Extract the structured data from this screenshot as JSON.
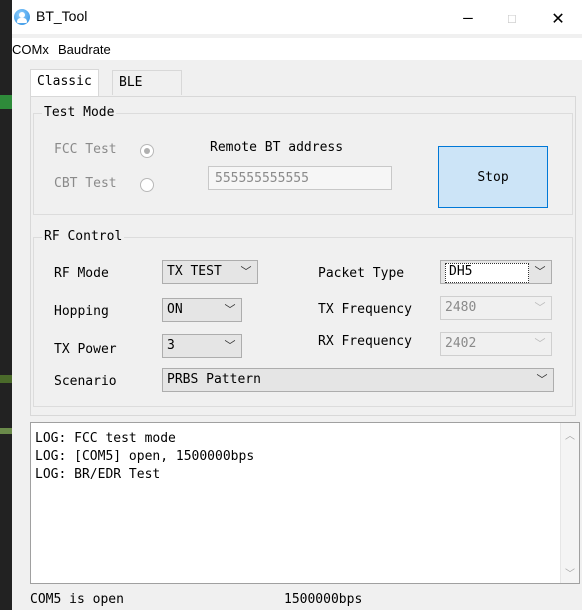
{
  "window": {
    "title": "BT_Tool",
    "minimize_glyph": "—",
    "maximize_glyph": "☐",
    "close_glyph": "✕"
  },
  "menu": {
    "items": [
      "COMx",
      "Baudrate"
    ]
  },
  "tabs": [
    {
      "label": "Classic",
      "active": true
    },
    {
      "label": "BLE",
      "active": false
    }
  ],
  "test_mode": {
    "title": "Test Mode",
    "options": [
      {
        "label": "FCC Test",
        "checked": true
      },
      {
        "label": "CBT Test",
        "checked": false
      }
    ],
    "remote_label": "Remote BT address",
    "remote_value": "555555555555",
    "stop_button": "Stop"
  },
  "rf_control": {
    "title": "RF Control",
    "rf_mode": {
      "label": "RF Mode",
      "value": "TX TEST"
    },
    "packet_type": {
      "label": "Packet Type",
      "value": "DH5"
    },
    "hopping": {
      "label": "Hopping",
      "value": "ON"
    },
    "tx_frequency": {
      "label": "TX Frequency",
      "value": "2480"
    },
    "tx_power": {
      "label": "TX Power",
      "value": "3"
    },
    "rx_frequency": {
      "label": "RX Frequency",
      "value": "2402"
    },
    "scenario": {
      "label": "Scenario",
      "value": "PRBS Pattern"
    }
  },
  "log": {
    "lines": [
      "LOG: FCC test mode",
      "LOG: [COM5] open, 1500000bps",
      "LOG: BR/EDR Test"
    ]
  },
  "status": {
    "port": "COM5 is open",
    "baud": "1500000bps"
  },
  "colors": {
    "accent": "#0078d7",
    "button_fill": "#cce4f7"
  },
  "icons": {
    "dropdown": "chevron-down-icon",
    "scroll_up": "scroll-up-icon",
    "scroll_down": "scroll-down-icon"
  }
}
